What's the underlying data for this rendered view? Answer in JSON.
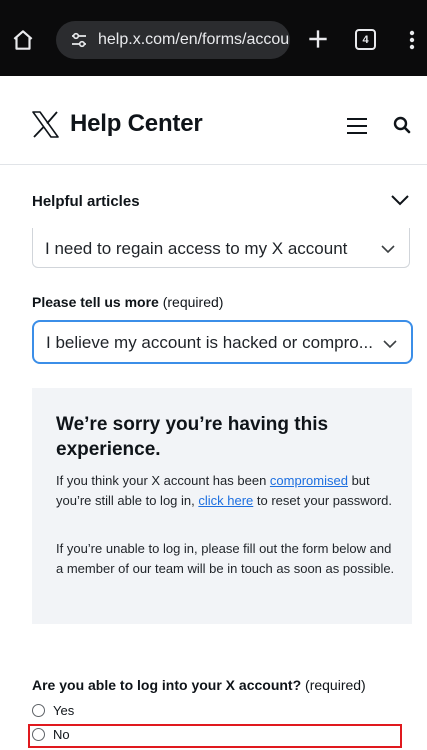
{
  "browser": {
    "url": "help.x.com/en/forms/accou",
    "tab_count": "4"
  },
  "header": {
    "title": "Help Center"
  },
  "helpful_articles": {
    "label": "Helpful articles"
  },
  "form": {
    "select_issue_value": "I need to regain access to my X account",
    "tell_more_label": "Please tell us more",
    "tell_more_required": "(required)",
    "tell_more_value": "I believe my account is hacked or compro..."
  },
  "info_card": {
    "heading": "We’re sorry you’re having this experience.",
    "p1_a": "If you think your X account has been ",
    "p1_link1": "compromised",
    "p1_b": " but you’re still able to log in, ",
    "p1_link2": "click here",
    "p1_c": " to reset your password.",
    "p2": "If you’re unable to log in, please fill out the form below and a member of our team will be in touch as soon as possible."
  },
  "question": {
    "label": "Are you able to log into your X account?",
    "required": "(required)",
    "options": [
      "Yes",
      "No"
    ]
  }
}
